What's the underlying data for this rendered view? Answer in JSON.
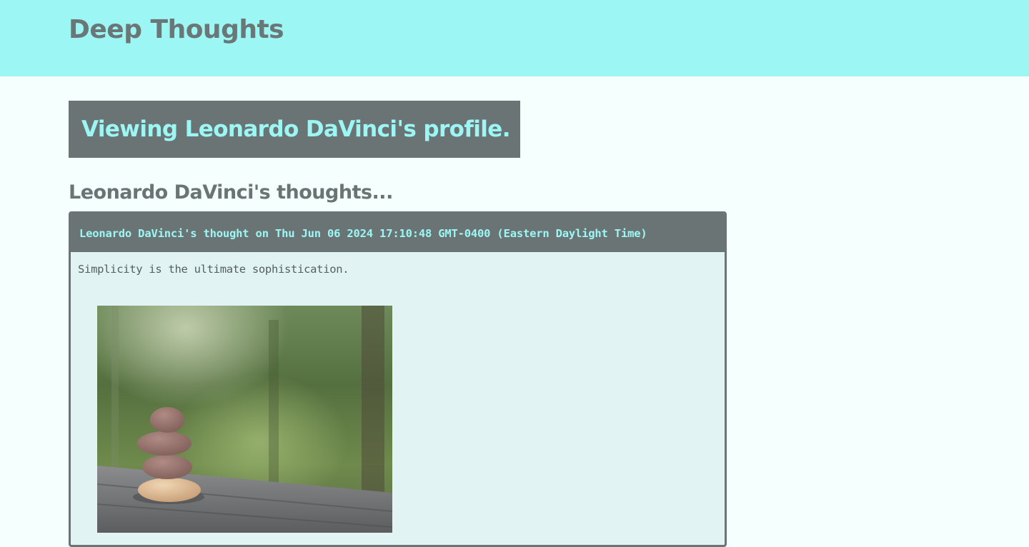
{
  "header": {
    "site_title": "Deep Thoughts",
    "background_color": "#9cf7f4"
  },
  "profile": {
    "banner_text": "Viewing Leonardo DaVinci's profile.",
    "thoughts_heading": "Leonardo DaVinci's thoughts..."
  },
  "thoughts": [
    {
      "header_text": "Leonardo DaVinci's thought on Thu Jun 06 2024 17:10:48 GMT-0400 (Eastern Daylight Time)",
      "text": "Simplicity is the ultimate sophistication.",
      "image_icon": "stacked-stones-photo"
    }
  ],
  "colors": {
    "accent": "#9cf7f4",
    "dark": "#6a7475",
    "page_background": "#f4fffe",
    "card_background": "#e1f3f2"
  }
}
